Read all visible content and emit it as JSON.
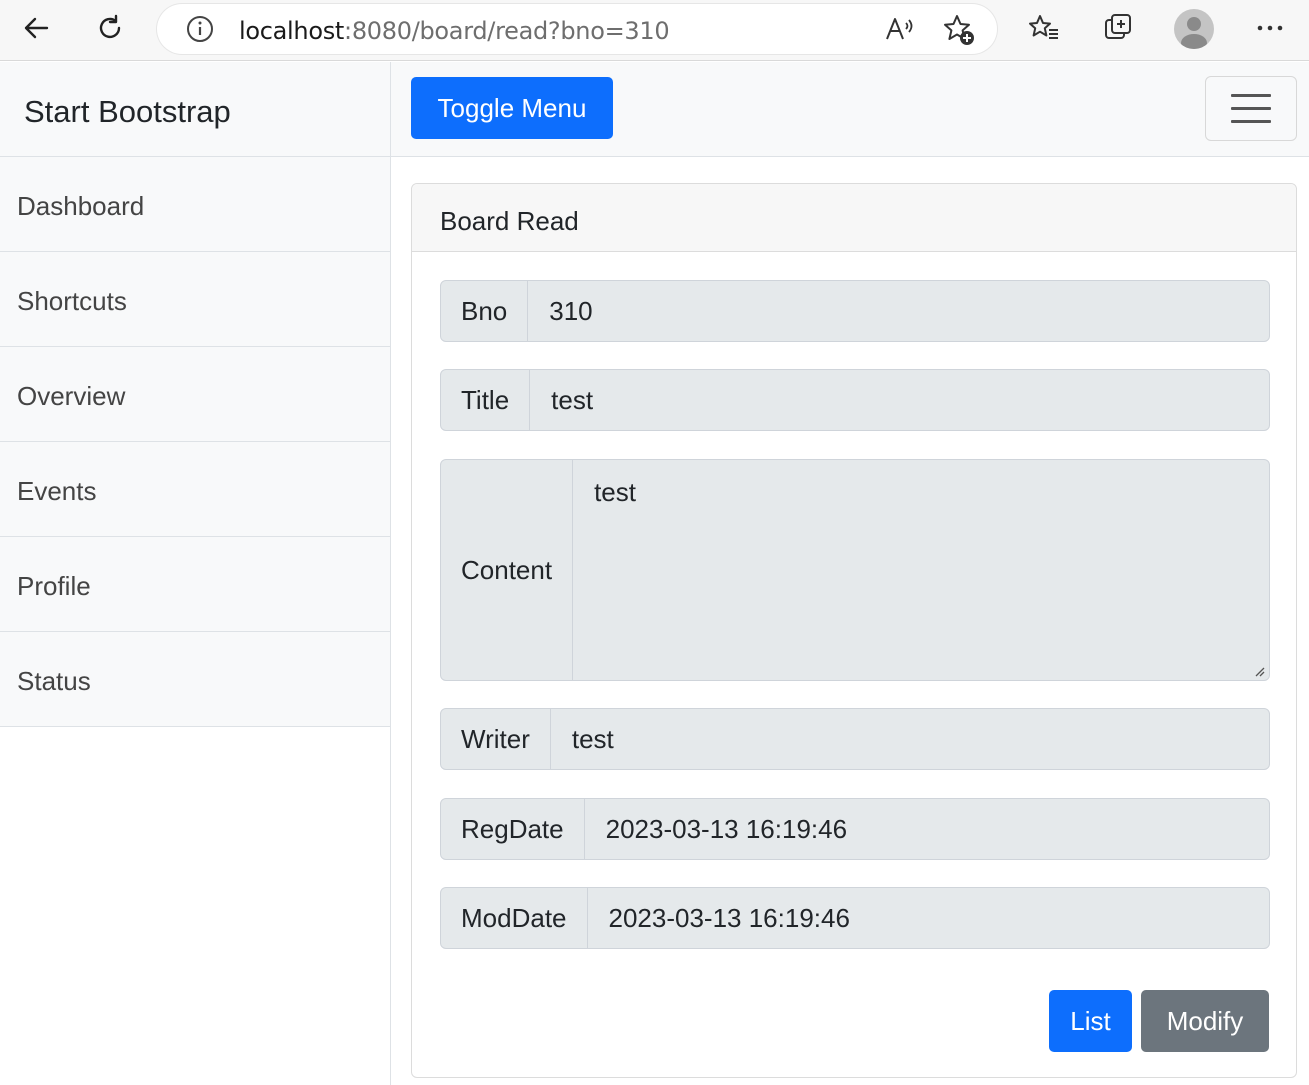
{
  "browser": {
    "url_host": "localhost",
    "url_rest": ":8080/board/read?bno=310"
  },
  "sidebar": {
    "heading": "Start Bootstrap",
    "items": [
      {
        "label": "Dashboard"
      },
      {
        "label": "Shortcuts"
      },
      {
        "label": "Overview"
      },
      {
        "label": "Events"
      },
      {
        "label": "Profile"
      },
      {
        "label": "Status"
      }
    ]
  },
  "navbar": {
    "toggle_label": "Toggle Menu",
    "menu_icon": "hamburger-icon"
  },
  "card": {
    "header": "Board Read",
    "fields": {
      "bno": {
        "label": "Bno",
        "value": "310"
      },
      "title": {
        "label": "Title",
        "value": "test"
      },
      "content": {
        "label": "Content",
        "value": "test"
      },
      "writer": {
        "label": "Writer",
        "value": "test"
      },
      "regdate": {
        "label": "RegDate",
        "value": "2023-03-13 16:19:46"
      },
      "moddate": {
        "label": "ModDate",
        "value": "2023-03-13 16:19:46"
      }
    },
    "buttons": {
      "list": "List",
      "modify": "Modify"
    }
  },
  "colors": {
    "primary": "#0d6efd",
    "secondary": "#6c757d",
    "readonly_bg": "#e5e9eb"
  }
}
